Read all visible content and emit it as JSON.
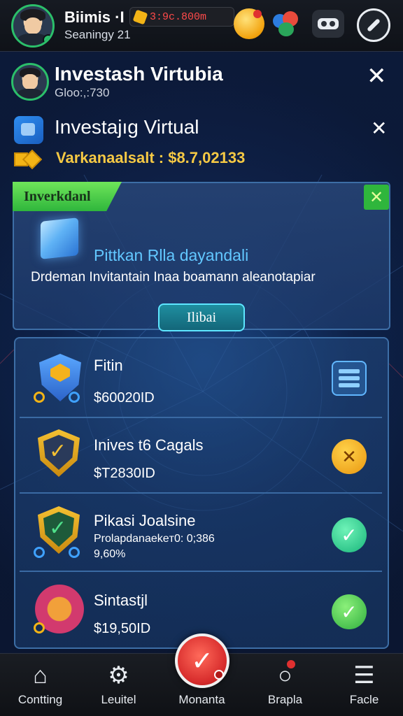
{
  "top_bar": {
    "name": "Biimis ·I",
    "subtitle": "Seaningy 21",
    "coin_value": "3:9c.800m"
  },
  "header": {
    "title": "Investash Virtubia",
    "subtitle": "Gloo:,:730"
  },
  "section": {
    "title": "Investajıg Virtual",
    "balance": "Varkanaalsalt : $8.7,02133"
  },
  "panel": {
    "tag": "Inverkdanl",
    "heading": "Pittkan Rlla dayandali",
    "description": "Drdeman Invitantain Inaa boamann aleanotapiar",
    "button": "Ilibai"
  },
  "list": [
    {
      "title": "Fitin",
      "value": "$60020ID"
    },
    {
      "title": "Inives t6 Cagals",
      "value": "$T2830ID"
    },
    {
      "title": "Pikasi Joalsine",
      "detail": "Prolapdanaekeт0: 0;386",
      "value": "9,60%"
    },
    {
      "title": "Sintastjl",
      "value": "$19,50ID"
    }
  ],
  "nav": [
    {
      "label": "Contting",
      "icon": "home-icon"
    },
    {
      "label": "Leuitel",
      "icon": "gear-icon"
    },
    {
      "label": "Monanta",
      "icon": "checkmark-icon"
    },
    {
      "label": "Brapla",
      "icon": "search-icon"
    },
    {
      "label": "Facle",
      "icon": "list-icon"
    }
  ]
}
